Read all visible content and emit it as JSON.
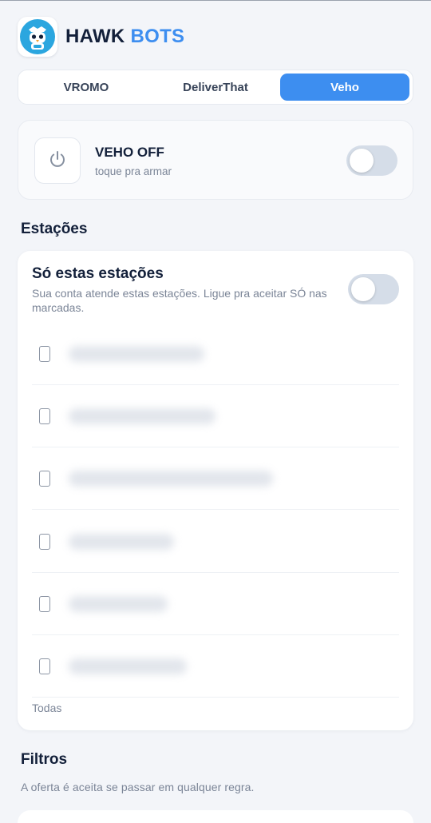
{
  "header": {
    "brand_part1": "HAWK",
    "brand_part2": "BOTS",
    "logo_icon": "robot-icon"
  },
  "tabs": [
    {
      "label": "VROMO",
      "active": false
    },
    {
      "label": "DeliverThat",
      "active": false
    },
    {
      "label": "Veho",
      "active": true
    }
  ],
  "status": {
    "title": "VEHO OFF",
    "subtitle": "toque pra armar",
    "icon": "power-icon",
    "armed": false
  },
  "stations_section": {
    "title": "Estações",
    "card_title": "Só estas estações",
    "description": "Sua conta atende estas estações. Ligue pra aceitar SÓ nas marcadas.",
    "only_these_enabled": false,
    "items": [
      {
        "checked": false
      },
      {
        "checked": false
      },
      {
        "checked": false
      },
      {
        "checked": false
      },
      {
        "checked": false
      },
      {
        "checked": false
      }
    ],
    "all_label": "Todas"
  },
  "filters_section": {
    "title": "Filtros",
    "note": "A oferta é aceita se passar em qualquer regra."
  },
  "colors": {
    "accent": "#3d8ef0",
    "background": "#f3f5f9",
    "toggle_off": "#d5dde8"
  }
}
